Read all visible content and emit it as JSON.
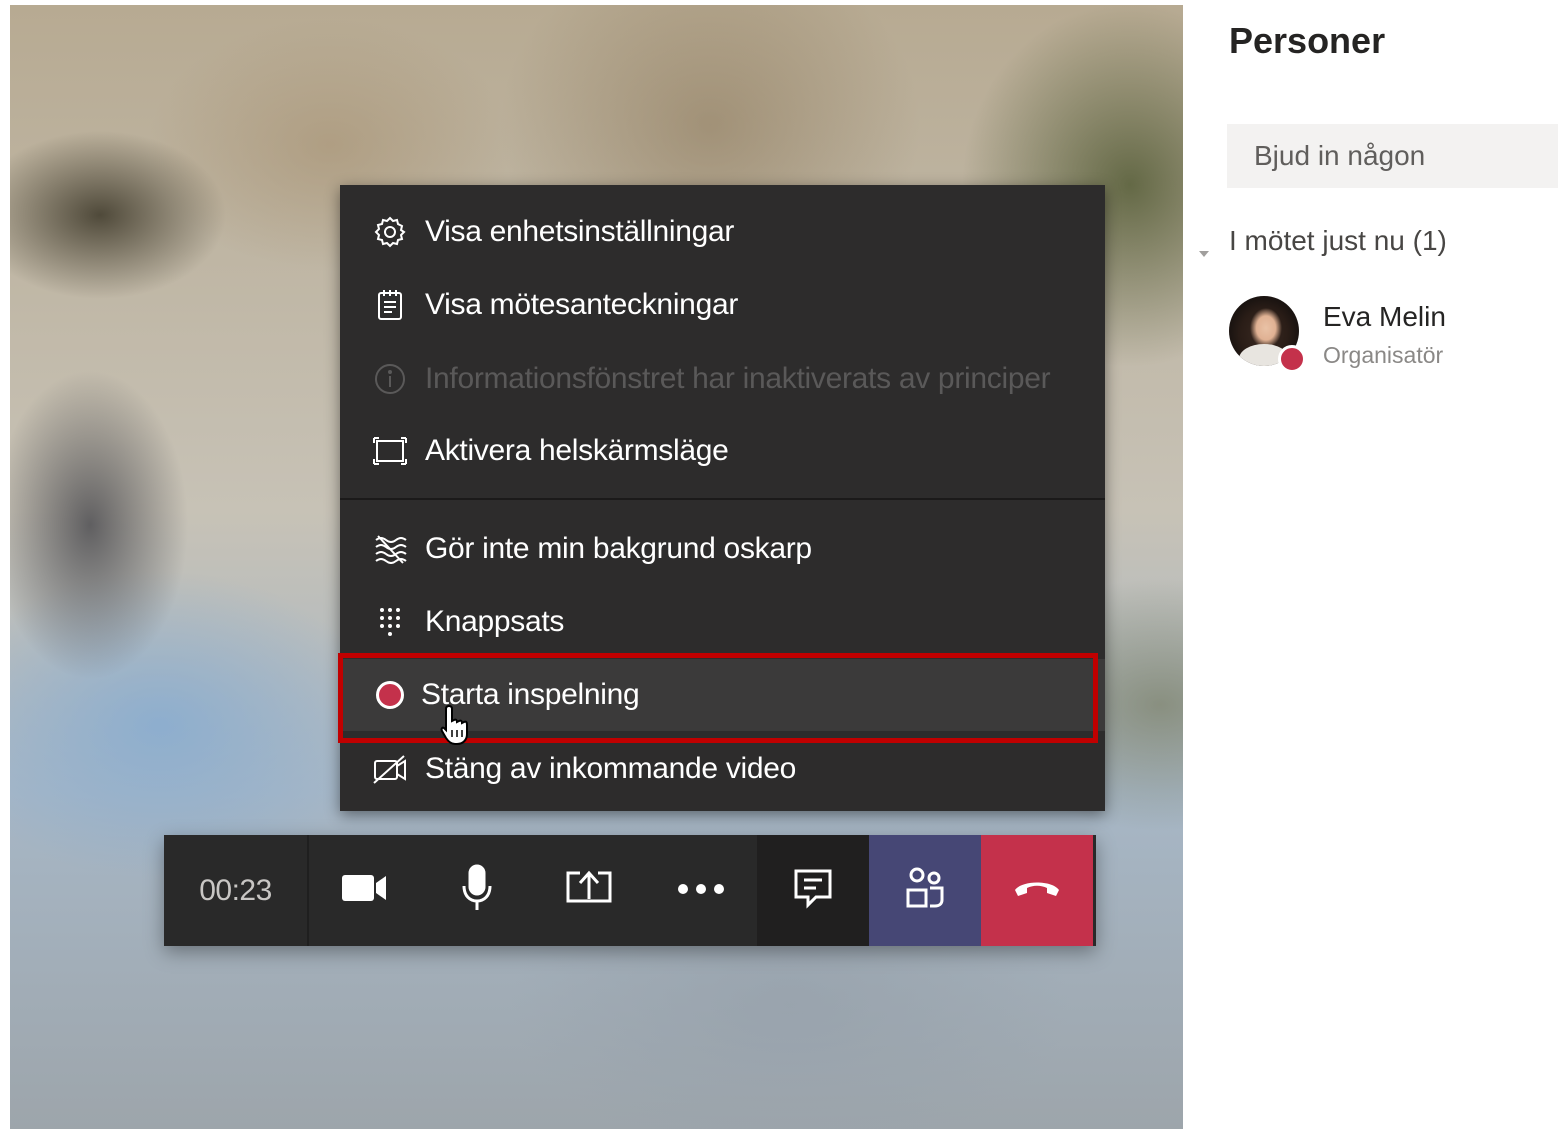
{
  "menu": {
    "items": [
      {
        "label": "Visa enhetsinställningar",
        "icon": "gear-icon",
        "enabled": true
      },
      {
        "label": "Visa mötesanteckningar",
        "icon": "notes-icon",
        "enabled": true
      },
      {
        "label": "Informationsfönstret har inaktiverats av principer",
        "icon": "info-icon",
        "enabled": false
      },
      {
        "label": "Aktivera helskärmsläge",
        "icon": "fullscreen-icon",
        "enabled": true
      },
      {
        "label": "Gör inte min bakgrund oskarp",
        "icon": "blur-icon",
        "enabled": true
      },
      {
        "label": "Knappsats",
        "icon": "dialpad-icon",
        "enabled": true
      },
      {
        "label": "Starta inspelning",
        "icon": "record-icon",
        "enabled": true,
        "highlighted": true
      },
      {
        "label": "Stäng av inkommande video",
        "icon": "video-off-icon",
        "enabled": true
      }
    ]
  },
  "toolbar": {
    "timer": "00:23",
    "buttons": [
      "camera-icon",
      "microphone-icon",
      "share-screen-icon",
      "more-options-icon",
      "chat-icon",
      "people-icon",
      "hang-up-icon"
    ]
  },
  "panel": {
    "title": "Personer",
    "invite_placeholder": "Bjud in någon",
    "section_label": "I mötet just nu (1)",
    "participants": [
      {
        "name": "Eva Melin",
        "role": "Organisatör",
        "presence": "busy"
      }
    ]
  },
  "colors": {
    "highlight_border": "#c00000",
    "hangup": "#c4314b",
    "people_active": "#464775",
    "menu_bg": "#2d2c2c"
  }
}
